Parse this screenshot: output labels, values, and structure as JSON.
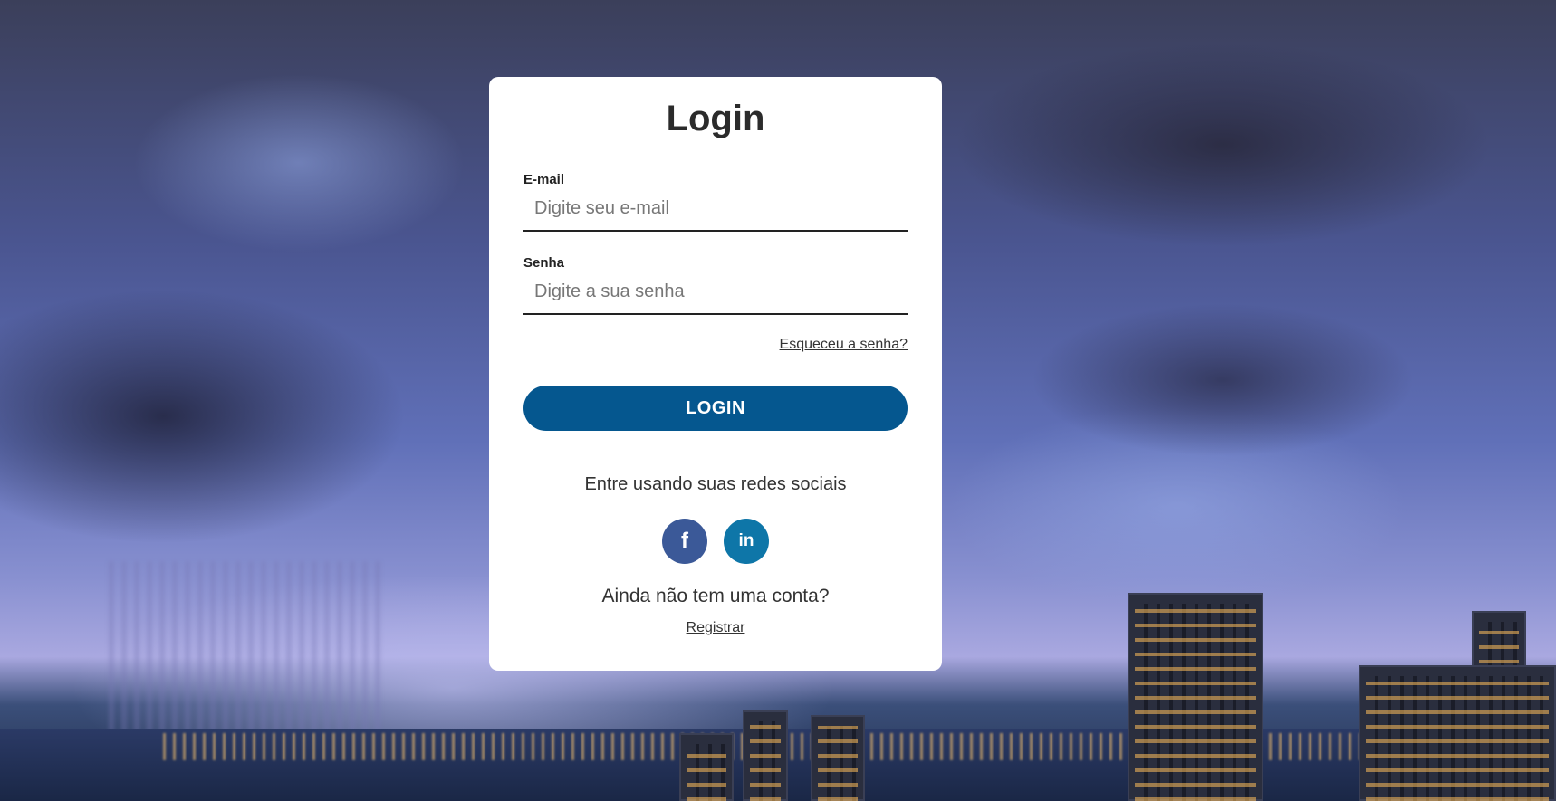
{
  "login": {
    "title": "Login",
    "email": {
      "label": "E-mail",
      "placeholder": "Digite seu e-mail",
      "value": ""
    },
    "password": {
      "label": "Senha",
      "placeholder": "Digite a sua senha",
      "value": ""
    },
    "forgot_link": "Esqueceu a senha?",
    "submit_label": "LOGIN",
    "social_text": "Entre usando suas redes sociais",
    "social": [
      {
        "name": "facebook",
        "glyph": "f",
        "icon": "facebook-icon",
        "color": "#3b5998"
      },
      {
        "name": "linkedin",
        "glyph": "in",
        "icon": "linkedin-icon",
        "color": "#0e76a8"
      }
    ],
    "no_account_text": "Ainda não tem uma conta?",
    "register_link": "Registrar"
  },
  "colors": {
    "primary": "#05578f",
    "card_background": "#ffffff",
    "text": "#333333"
  }
}
